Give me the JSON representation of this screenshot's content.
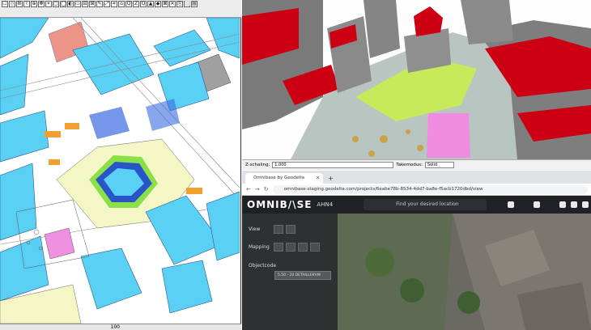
{
  "cad": {
    "toolbar_glyphs": [
      "☐",
      "◇",
      "Ⅲ",
      "⌇",
      "⊕",
      "✥",
      "⌖",
      "▢",
      "◯",
      "◐",
      "▭",
      "⊟",
      "⊞",
      "✎",
      "⤢",
      "⌗",
      "⌂",
      "Q",
      "Z",
      "Q",
      "▲",
      "◆",
      "⊠",
      "✕",
      "⎘",
      "⬜",
      "▤"
    ],
    "status_scale": "100"
  },
  "viewer3d": {
    "zscale_label": "Z-schaling:",
    "zscale_value": "1,000",
    "takemode_label": "Takemodus:",
    "takemode_value": "Solid"
  },
  "browser": {
    "tab_title": "Omnibase by Geodelta",
    "tab_close": "×",
    "new_tab": "+",
    "url": "omnibase-staging.geodelta.com/projects/6eabe78b-8534-4dd7-ba8e-f5acb1720dbd/view"
  },
  "app": {
    "brand": "OMNIB/\\SE",
    "layer": "AHN4",
    "search_placeholder": "Find your desired location",
    "panel": {
      "view_label": "View",
      "mapping_label": "Mapping",
      "objectcode_label": "Objectcode",
      "objectcode_value": "5.50 - 20 DETAILLEKVW"
    }
  },
  "colors": {
    "building_cyan": "#5ad0f5",
    "red_roof": "#cc0012",
    "green_plaza": "#c8e95a",
    "pink": "#f08ce0"
  }
}
